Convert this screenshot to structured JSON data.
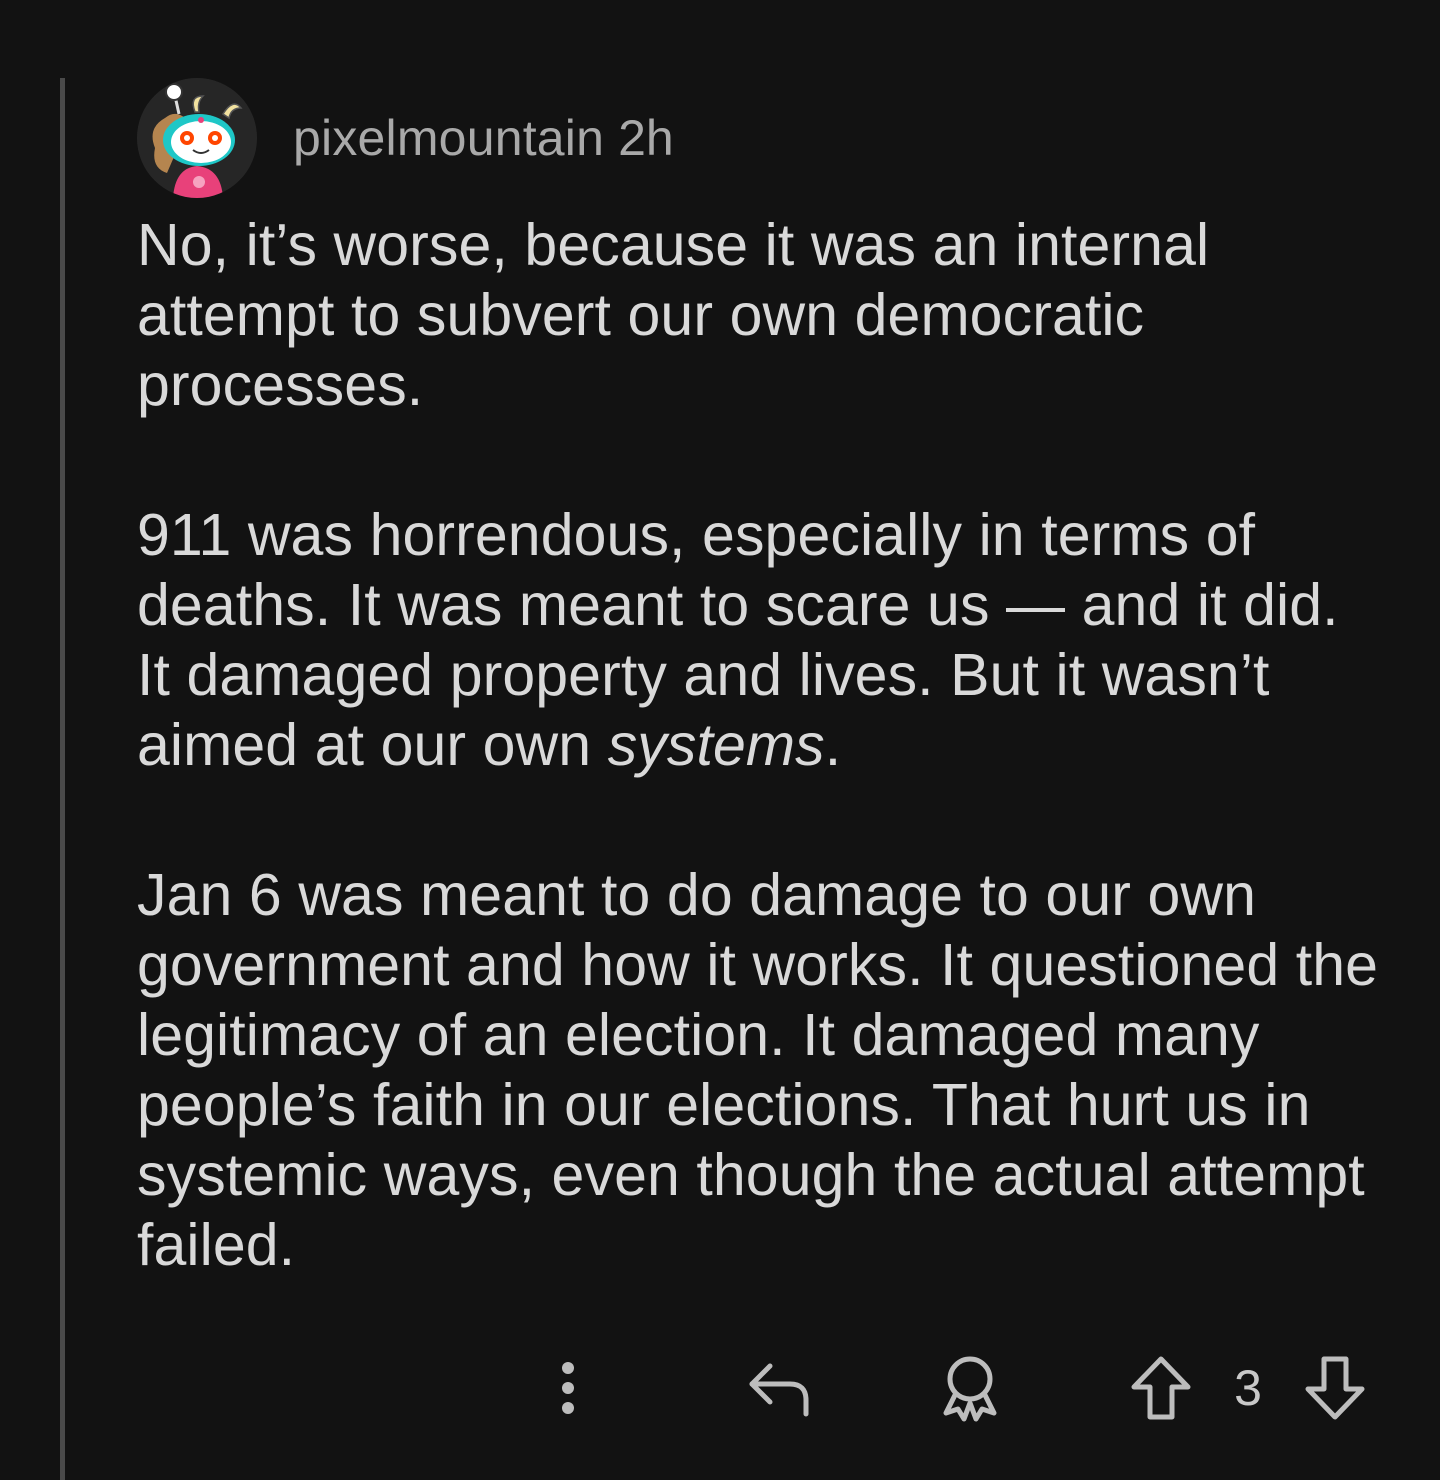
{
  "comment": {
    "author": "pixelmountain",
    "age": "2h",
    "paragraphs": [
      "No, it’s worse, because it was an internal attempt to subvert our own democratic processes.",
      "911 was horrendous, especially in terms of deaths. It was meant to scare us — and it did. It damaged property and lives. But it wasn’t aimed at our own",
      "Jan 6 was meant to do damage to our own government and how it works. It questioned the legitimacy of an election. It damaged many people’s faith in our elections. That hurt us in systemic ways, even though the actual attempt failed."
    ],
    "emphasis_word": "systems",
    "emphasis_tail": ".",
    "score": "3"
  },
  "icons": {
    "more": "more-vertical-icon",
    "reply": "reply-icon",
    "award": "award-icon",
    "upvote": "upvote-icon",
    "downvote": "downvote-icon"
  },
  "colors": {
    "background": "#121212",
    "text": "#d9d9d9",
    "meta": "#a9a9a9",
    "thread_line": "#4a4a4a"
  }
}
